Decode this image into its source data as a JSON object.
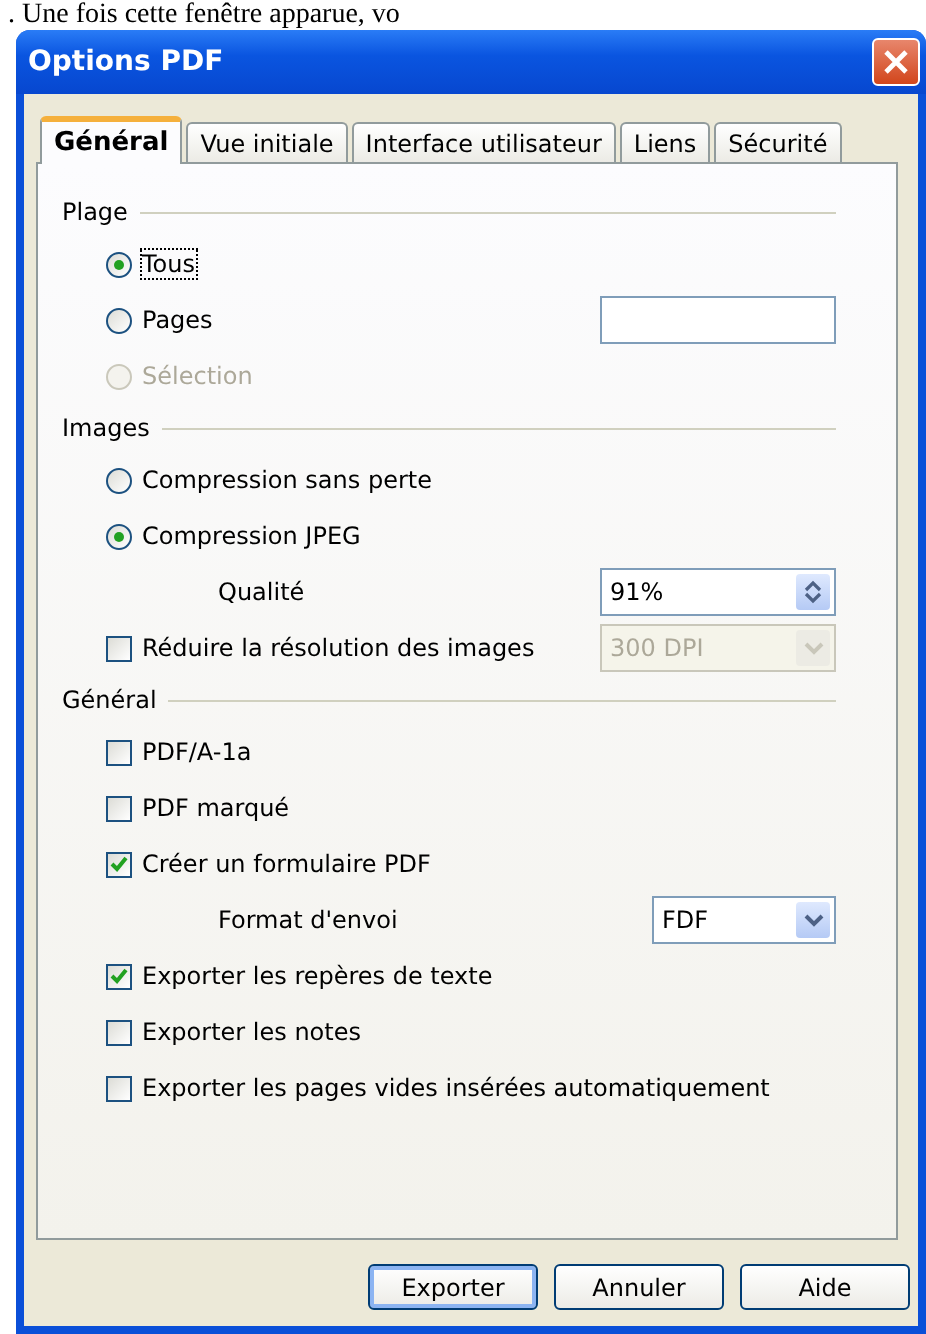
{
  "background_text": ". Une fois cette fenêtre apparue, vo",
  "window": {
    "title": "Options PDF"
  },
  "tabs": [
    {
      "label": "Général",
      "selected": true
    },
    {
      "label": "Vue initiale",
      "selected": false
    },
    {
      "label": "Interface utilisateur",
      "selected": false
    },
    {
      "label": "Liens",
      "selected": false
    },
    {
      "label": "Sécurité",
      "selected": false
    }
  ],
  "sections": [
    {
      "title": "Plage",
      "items": [
        {
          "kind": "radio",
          "label": "Tous",
          "selected": true,
          "disabled": false,
          "focused": true
        },
        {
          "kind": "radio",
          "label": "Pages",
          "selected": false,
          "disabled": false,
          "field": {
            "disabled": false
          }
        },
        {
          "kind": "radio",
          "label": "Sélection",
          "selected": false,
          "disabled": true
        }
      ]
    },
    {
      "title": "Images",
      "items": [
        {
          "kind": "radio",
          "label": "Compression sans perte",
          "selected": false,
          "disabled": false
        },
        {
          "kind": "radio",
          "label": "Compression JPEG",
          "selected": true,
          "disabled": false
        },
        {
          "kind": "spin",
          "label": "Qualité",
          "value": "91%",
          "disabled": false
        },
        {
          "kind": "checkbox",
          "label": "Réduire la résolution des images",
          "checked": false,
          "disabled": false,
          "select": {
            "value": "300 DPI",
            "disabled": true
          }
        }
      ]
    },
    {
      "title": "Général",
      "items": [
        {
          "kind": "checkbox",
          "label": "PDF/A-1a",
          "checked": false,
          "disabled": false
        },
        {
          "kind": "checkbox",
          "label": "PDF marqué",
          "checked": false,
          "disabled": false
        },
        {
          "kind": "checkbox",
          "label": "Créer un formulaire PDF",
          "checked": true,
          "disabled": false
        },
        {
          "kind": "select",
          "label": "Format d'envoi",
          "value": "FDF",
          "disabled": false
        },
        {
          "kind": "checkbox",
          "label": "Exporter les repères de texte",
          "checked": true,
          "disabled": false
        },
        {
          "kind": "checkbox",
          "label": "Exporter les notes",
          "checked": false,
          "disabled": false
        },
        {
          "kind": "checkbox",
          "label": "Exporter les pages vides insérées automatiquement",
          "checked": false,
          "disabled": false
        }
      ]
    }
  ],
  "buttons": [
    {
      "label": "Exporter",
      "default": true
    },
    {
      "label": "Annuler",
      "default": false
    },
    {
      "label": "Aide",
      "default": false
    }
  ]
}
